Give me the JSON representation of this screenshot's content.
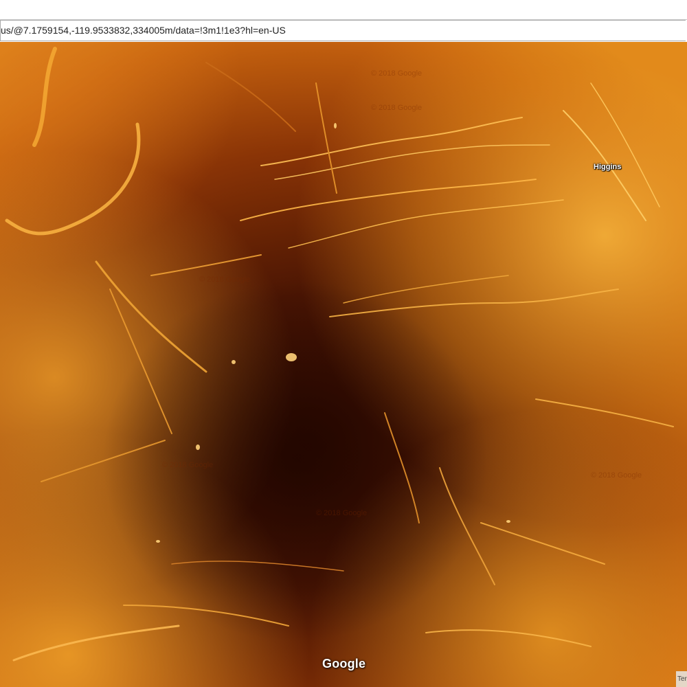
{
  "browser": {
    "url": "us/@7.1759154,-119.9533832,334005m/data=!3m1!1e3?hl=en-US"
  },
  "map": {
    "planet_colors": {
      "base_dark": "#3a0f02",
      "mid": "#9a3f07",
      "bright": "#f0a020",
      "highlight": "#ffd060"
    },
    "labels": [
      {
        "text": "Higgins"
      }
    ],
    "watermarks": [
      "© 2018 Google",
      "© 2018 Google",
      "© 2018 Google",
      "© 2018 Google",
      "© 2018 Google",
      "© 2018 Google"
    ],
    "logo": "Google",
    "attribution": "Ter"
  }
}
